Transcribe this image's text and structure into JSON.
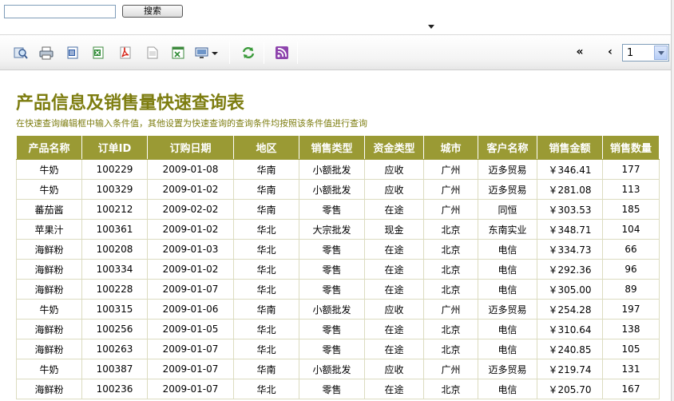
{
  "search": {
    "value": "",
    "button_label": "搜索"
  },
  "toolbar": {
    "icons": [
      "query-icon",
      "print-icon",
      "export-word-icon",
      "export-excel-icon",
      "export-pdf-icon",
      "export-text-icon",
      "export-excel-data-icon",
      "screen-dropdown-icon",
      "refresh-icon",
      "rss-icon"
    ],
    "pager": {
      "first_label": "«",
      "prev_label": "‹",
      "page_value": "1"
    }
  },
  "report": {
    "title": "产品信息及销售量快速查询表",
    "subtitle": "在快速查询编辑框中输入条件值，其他设置为快速查询的查询条件均按照该条件值进行查询",
    "columns": [
      "产品名称",
      "订单ID",
      "订购日期",
      "地区",
      "销售类型",
      "资金类型",
      "城市",
      "客户名称",
      "销售金额",
      "销售数量"
    ],
    "rows": [
      [
        "牛奶",
        "100229",
        "2009-01-08",
        "华南",
        "小额批发",
        "应收",
        "广州",
        "迈多贸易",
        "￥346.41",
        "177"
      ],
      [
        "牛奶",
        "100329",
        "2009-01-02",
        "华南",
        "小额批发",
        "应收",
        "广州",
        "迈多贸易",
        "￥281.08",
        "113"
      ],
      [
        "蕃茄酱",
        "100212",
        "2009-02-02",
        "华南",
        "零售",
        "在途",
        "广州",
        "同恒",
        "￥303.53",
        "185"
      ],
      [
        "苹果汁",
        "100361",
        "2009-01-02",
        "华北",
        "大宗批发",
        "现金",
        "北京",
        "东南实业",
        "￥348.71",
        "104"
      ],
      [
        "海鲜粉",
        "100208",
        "2009-01-03",
        "华北",
        "零售",
        "在途",
        "北京",
        "电信",
        "￥334.73",
        "66"
      ],
      [
        "海鲜粉",
        "100334",
        "2009-01-02",
        "华北",
        "零售",
        "在途",
        "北京",
        "电信",
        "￥292.36",
        "96"
      ],
      [
        "海鲜粉",
        "100228",
        "2009-01-07",
        "华北",
        "零售",
        "在途",
        "北京",
        "电信",
        "￥305.00",
        "89"
      ],
      [
        "牛奶",
        "100315",
        "2009-01-06",
        "华南",
        "小额批发",
        "应收",
        "广州",
        "迈多贸易",
        "￥254.28",
        "197"
      ],
      [
        "海鲜粉",
        "100256",
        "2009-01-05",
        "华北",
        "零售",
        "在途",
        "北京",
        "电信",
        "￥310.64",
        "138"
      ],
      [
        "海鲜粉",
        "100263",
        "2009-01-07",
        "华北",
        "零售",
        "在途",
        "北京",
        "电信",
        "￥240.85",
        "105"
      ],
      [
        "牛奶",
        "100387",
        "2009-01-07",
        "华南",
        "小额批发",
        "应收",
        "广州",
        "迈多贸易",
        "￥219.74",
        "131"
      ],
      [
        "海鲜粉",
        "100236",
        "2009-01-07",
        "华北",
        "零售",
        "在途",
        "北京",
        "电信",
        "￥205.70",
        "167"
      ]
    ]
  },
  "colors": {
    "accent": "#9a9a34",
    "title": "#7d7d10"
  }
}
